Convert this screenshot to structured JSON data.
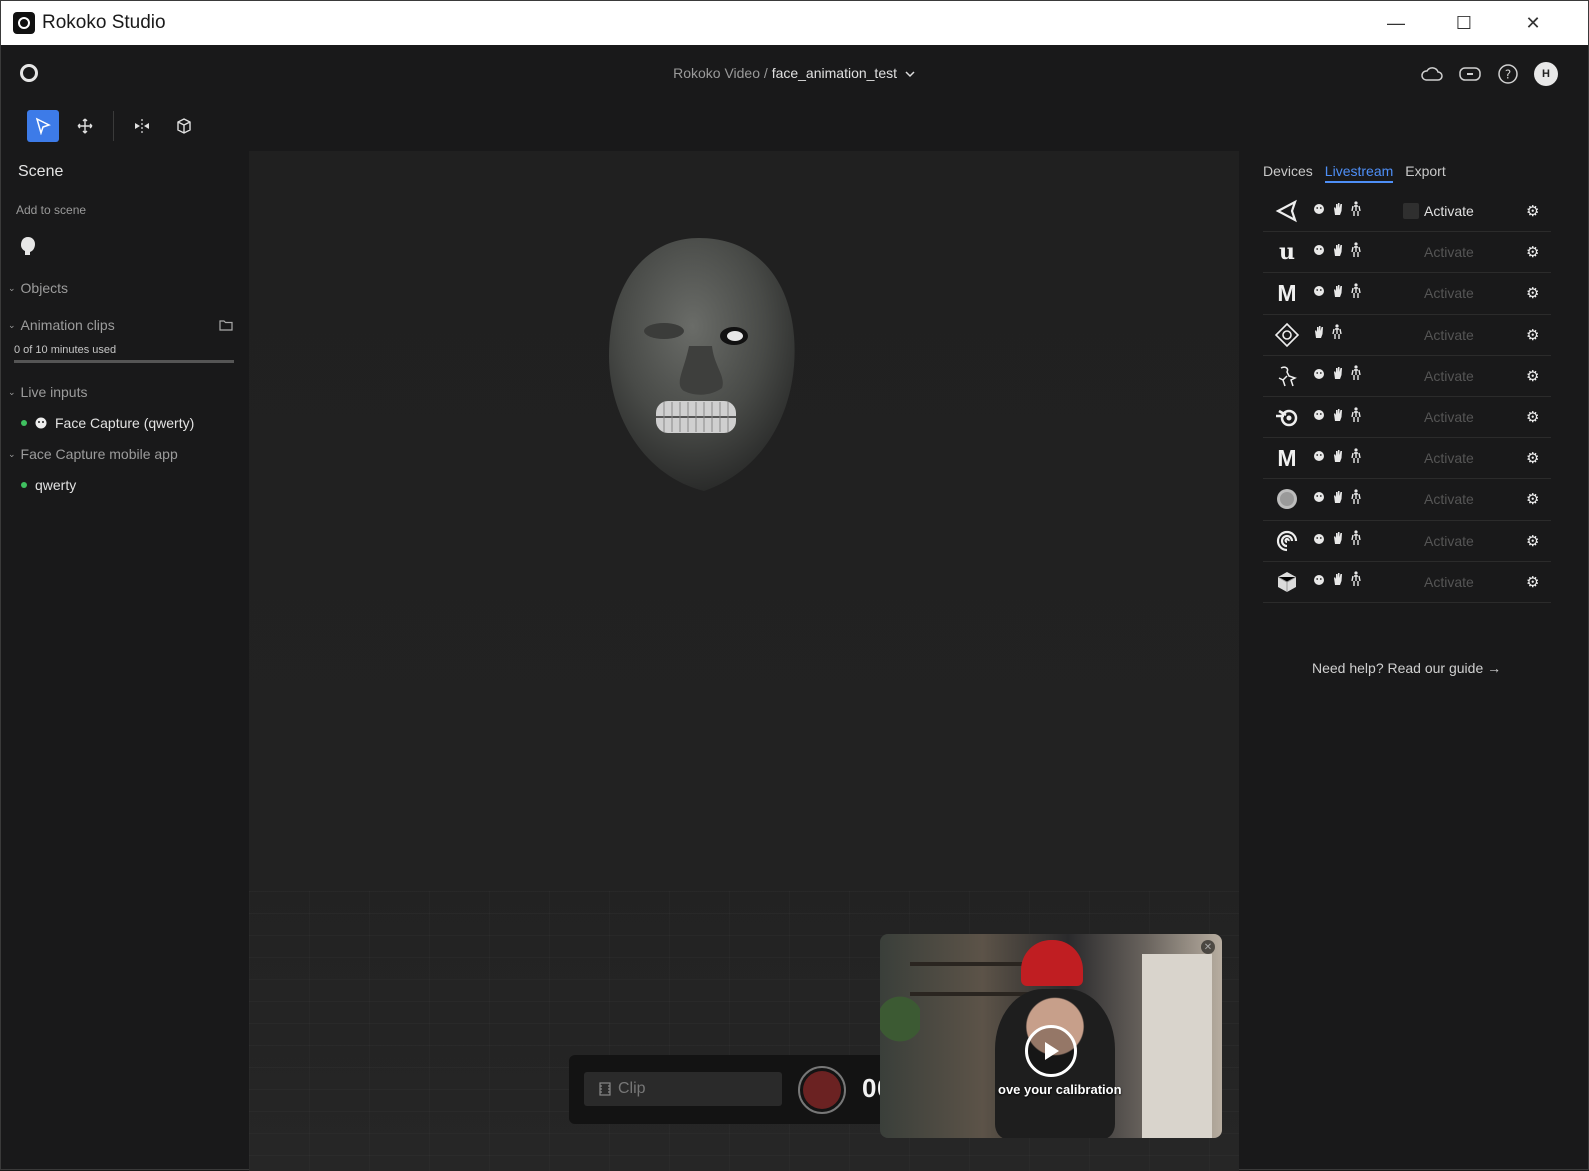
{
  "window": {
    "title": "Rokoko Studio",
    "minimize": "—",
    "maximize": "☐",
    "close": "✕"
  },
  "header": {
    "workspace": "Rokoko Video",
    "separator": "/",
    "project": "face_animation_test",
    "avatar_initial": "H"
  },
  "left_panel": {
    "scene_title": "Scene",
    "add_to_scene": "Add to scene",
    "objects": "Objects",
    "animation_clips": "Animation clips",
    "minutes_used": "0 of 10 minutes used",
    "minutes_fraction": 0.0,
    "live_inputs": "Live inputs",
    "live_input_item": "Face Capture (qwerty)",
    "mobile_app": "Face Capture mobile app",
    "mobile_app_item": "qwerty"
  },
  "recorder": {
    "clip_placeholder": "Clip",
    "timer": "00:00:00"
  },
  "video": {
    "caption": "ove your calibration"
  },
  "right_panel": {
    "tabs": [
      "Devices",
      "Livestream",
      "Export"
    ],
    "active_tab": "Livestream",
    "activate_label": "Activate",
    "help_link": "Need help? Read our guide →",
    "integrations": [
      {
        "logo": "unity-icon",
        "active": true
      },
      {
        "logo": "unreal-icon",
        "active": false
      },
      {
        "logo": "maya-icon",
        "active": false
      },
      {
        "logo": "motionbuilder-icon",
        "active": false
      },
      {
        "logo": "character-icon",
        "active": false
      },
      {
        "logo": "blender-icon",
        "active": false
      },
      {
        "logo": "maya-m-icon",
        "active": false
      },
      {
        "logo": "sphere-icon",
        "active": false
      },
      {
        "logo": "houdini-icon",
        "active": false
      },
      {
        "logo": "cube-icon",
        "active": false
      }
    ]
  },
  "colors": {
    "accent": "#3d7be8",
    "tab_active": "#4e8ff7",
    "live_dot": "#3fc160",
    "record": "#6b2222"
  }
}
